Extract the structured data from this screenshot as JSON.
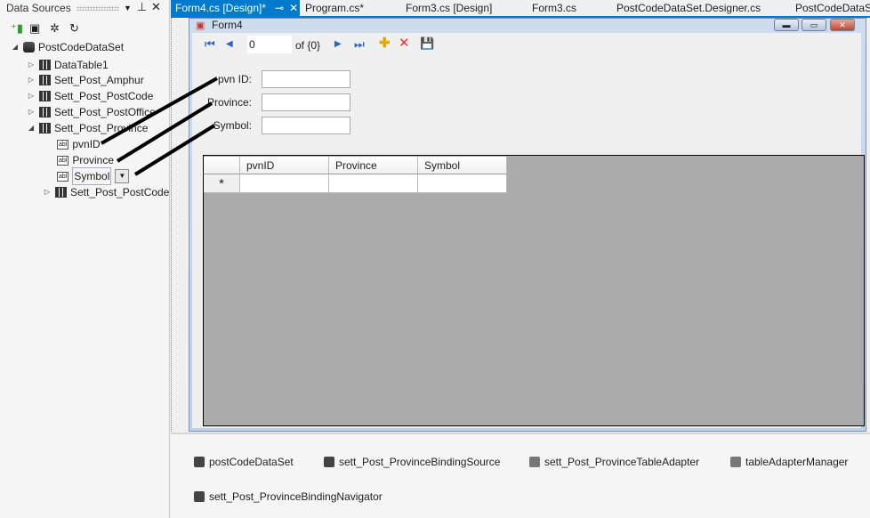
{
  "data_sources": {
    "title": "Data Sources",
    "tree": {
      "root": "PostCodeDataSet",
      "tables": [
        "DataTable1",
        "Sett_Post_Amphur",
        "Sett_Post_PostCode",
        "Sett_Post_PostOffice",
        "Sett_Post_Province"
      ],
      "fields": [
        "pvnID",
        "Province",
        "Symbol"
      ],
      "child": "Sett_Post_PostCode"
    }
  },
  "tabs": [
    "Form4.cs [Design]*",
    "Program.cs*",
    "Form3.cs [Design]",
    "Form3.cs",
    "PostCodeDataSet.Designer.cs",
    "PostCodeDataS"
  ],
  "form": {
    "title": "Form4",
    "navigator": {
      "position": "0",
      "count": "of {0}"
    },
    "labels": [
      "pvn ID:",
      "Province:",
      "Symbol:"
    ],
    "grid": {
      "columns": [
        "pvnID",
        "Province",
        "Symbol"
      ],
      "new_row_marker": "*"
    }
  },
  "tray": [
    "postCodeDataSet",
    "sett_Post_ProvinceBindingSource",
    "sett_Post_ProvinceTableAdapter",
    "tableAdapterManager",
    "sett_Post_ProvinceBindingNavigator"
  ]
}
